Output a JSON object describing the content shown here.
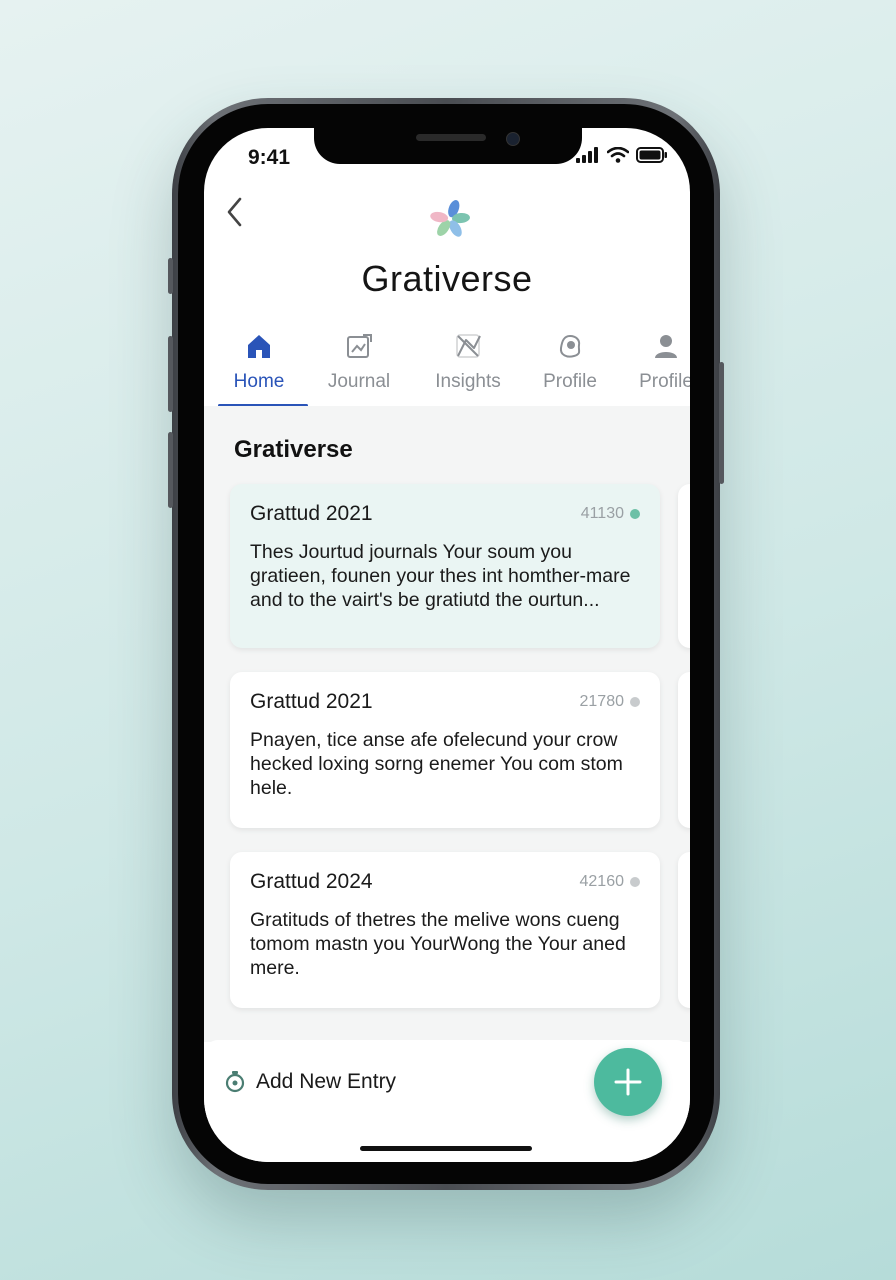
{
  "status": {
    "time": "9:41"
  },
  "header": {
    "app_title": "Grativerse"
  },
  "tabs": [
    {
      "label": "Home",
      "icon": "home-icon",
      "active": true
    },
    {
      "label": "Journal",
      "icon": "journal-icon",
      "active": false
    },
    {
      "label": "Insights",
      "icon": "insights-icon",
      "active": false
    },
    {
      "label": "Profile",
      "icon": "profile-badge-icon",
      "active": false
    },
    {
      "label": "Profile",
      "icon": "person-icon",
      "active": false
    }
  ],
  "main": {
    "section_title": "Grativerse",
    "entries": [
      {
        "title": "Grattud 2021",
        "number": "41130",
        "body": "Thes Jourtud journals Your soum you gratieen, founen your thes int homther-mare and to the vairt's be gratiutd the ourtun..."
      },
      {
        "title": "Grattud 2021",
        "number": "21780",
        "body": "Pnayen, tice anse afe ofelecund your crow hecked loxing sorng enemer You com stom hele."
      },
      {
        "title": "Grattud 2024",
        "number": "42160",
        "body": "Gratituds of thetres the melive wons cueng tomom mastn you YourWong the Your aned mere."
      }
    ]
  },
  "footer": {
    "add_label": "Add New Entry"
  },
  "colors": {
    "accent": "#2a54b8",
    "fab": "#4dba9e",
    "card_tint": "#eaf5f3",
    "status_green": "#6cc0a6"
  }
}
